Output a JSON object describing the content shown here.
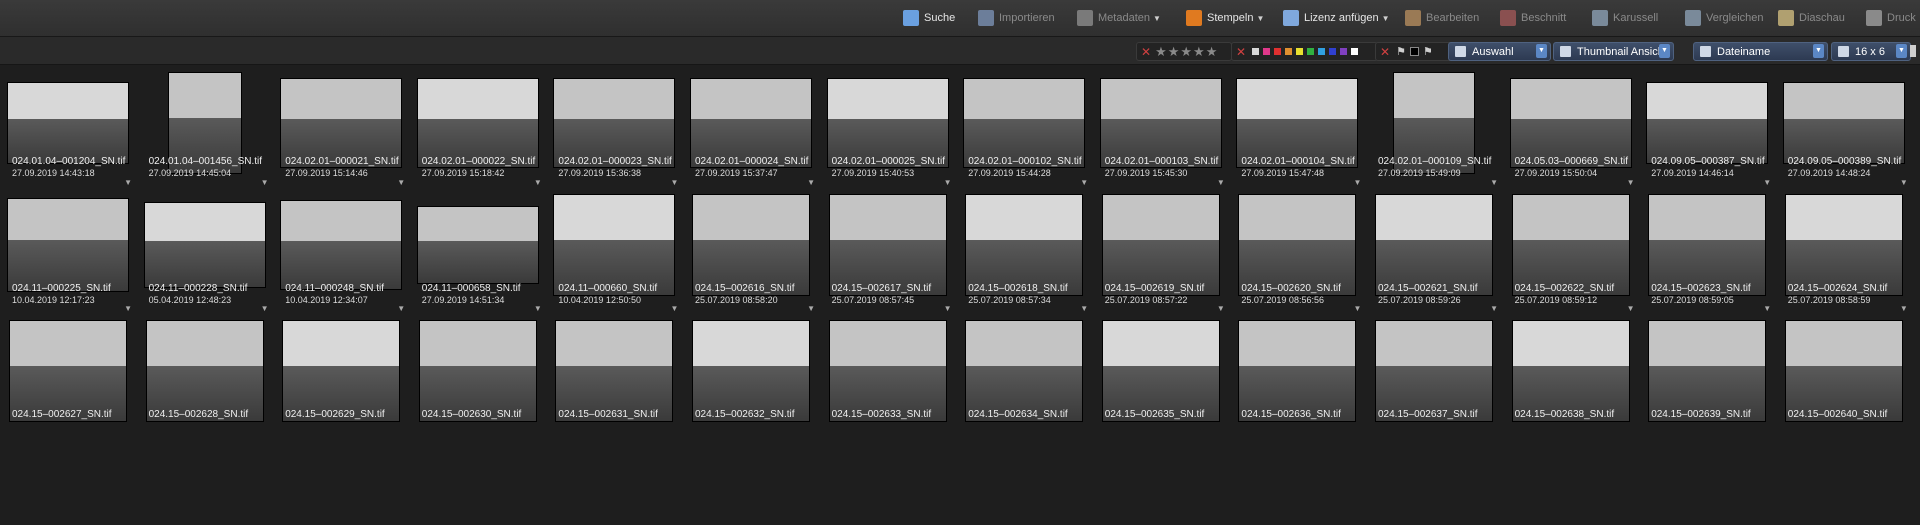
{
  "toolbar": {
    "items": [
      {
        "label": "Suche",
        "icon": "search-icon",
        "enabled": true,
        "caret": false
      },
      {
        "label": "Importieren",
        "icon": "import-icon",
        "enabled": false,
        "caret": false
      },
      {
        "label": "Metadaten",
        "icon": "metadata-icon",
        "enabled": false,
        "caret": true
      },
      {
        "label": "Stempeln",
        "icon": "stamp-icon",
        "enabled": true,
        "caret": true
      },
      {
        "label": "Lizenz anfügen",
        "icon": "license-icon",
        "enabled": true,
        "caret": true
      },
      {
        "label": "Bearbeiten",
        "icon": "palette-icon",
        "enabled": false,
        "caret": false
      },
      {
        "label": "Beschnitt",
        "icon": "crop-icon",
        "enabled": false,
        "caret": false
      },
      {
        "label": "Karussell",
        "icon": "carousel-icon",
        "enabled": false,
        "caret": false
      },
      {
        "label": "Vergleichen",
        "icon": "compare-icon",
        "enabled": false,
        "caret": false
      },
      {
        "label": "Diaschau",
        "icon": "slideshow-icon",
        "enabled": false,
        "caret": false
      },
      {
        "label": "Druck",
        "icon": "print-icon",
        "enabled": false,
        "caret": false
      }
    ]
  },
  "filters": {
    "rating_stars": 5,
    "colors": [
      "#d8d8d8",
      "#e0388a",
      "#e03030",
      "#e09030",
      "#e8e030",
      "#30b040",
      "#30a0e0",
      "#3040d0",
      "#8040c0",
      "#ffffff"
    ],
    "selection_dropdown": "Auswahl",
    "view_dropdown": "Thumbnail Ansicht",
    "sort_dropdown": "Dateiname",
    "grid_dropdown": "16 x 6"
  },
  "thumbnails": [
    {
      "name": "024.01.04–001204_SN.tif",
      "date": "27.09.2019 14:43:18"
    },
    {
      "name": "024.01.04–001456_SN.tif",
      "date": "27.09.2019 14:45:04"
    },
    {
      "name": "024.02.01–000021_SN.tif",
      "date": "27.09.2019 15:14:46"
    },
    {
      "name": "024.02.01–000022_SN.tif",
      "date": "27.09.2019 15:18:42"
    },
    {
      "name": "024.02.01–000023_SN.tif",
      "date": "27.09.2019 15:36:38"
    },
    {
      "name": "024.02.01–000024_SN.tif",
      "date": "27.09.2019 15:37:47"
    },
    {
      "name": "024.02.01–000025_SN.tif",
      "date": "27.09.2019 15:40:53"
    },
    {
      "name": "024.02.01–000102_SN.tif",
      "date": "27.09.2019 15:44:28"
    },
    {
      "name": "024.02.01–000103_SN.tif",
      "date": "27.09.2019 15:45:30"
    },
    {
      "name": "024.02.01–000104_SN.tif",
      "date": "27.09.2019 15:47:48"
    },
    {
      "name": "024.02.01–000109_SN.tif",
      "date": "27.09.2019 15:49:09"
    },
    {
      "name": "024.05.03–000669_SN.tif",
      "date": "27.09.2019 15:50:04"
    },
    {
      "name": "024.09.05–000387_SN.tif",
      "date": "27.09.2019 14:46:14"
    },
    {
      "name": "024.09.05–000389_SN.tif",
      "date": "27.09.2019 14:48:24"
    },
    {
      "name": "024.11–000225_SN.tif",
      "date": "10.04.2019 12:17:23"
    },
    {
      "name": "024.11–000228_SN.tif",
      "date": "05.04.2019 12:48:23"
    },
    {
      "name": "024.11–000248_SN.tif",
      "date": "10.04.2019 12:34:07"
    },
    {
      "name": "024.11–000658_SN.tif",
      "date": "27.09.2019 14:51:34"
    },
    {
      "name": "024.11–000660_SN.tif",
      "date": "10.04.2019 12:50:50"
    },
    {
      "name": "024.15–002616_SN.tif",
      "date": "25.07.2019 08:58:20"
    },
    {
      "name": "024.15–002617_SN.tif",
      "date": "25.07.2019 08:57:45"
    },
    {
      "name": "024.15–002618_SN.tif",
      "date": "25.07.2019 08:57:34"
    },
    {
      "name": "024.15–002619_SN.tif",
      "date": "25.07.2019 08:57:22"
    },
    {
      "name": "024.15–002620_SN.tif",
      "date": "25.07.2019 08:56:56"
    },
    {
      "name": "024.15–002621_SN.tif",
      "date": "25.07.2019 08:59:26"
    },
    {
      "name": "024.15–002622_SN.tif",
      "date": "25.07.2019 08:59:12"
    },
    {
      "name": "024.15–002623_SN.tif",
      "date": "25.07.2019 08:59:05"
    },
    {
      "name": "024.15–002624_SN.tif",
      "date": "25.07.2019 08:58:59"
    },
    {
      "name": "024.15–002627_SN.tif",
      "date": ""
    },
    {
      "name": "024.15–002628_SN.tif",
      "date": ""
    },
    {
      "name": "024.15–002629_SN.tif",
      "date": ""
    },
    {
      "name": "024.15–002630_SN.tif",
      "date": ""
    },
    {
      "name": "024.15–002631_SN.tif",
      "date": ""
    },
    {
      "name": "024.15–002632_SN.tif",
      "date": ""
    },
    {
      "name": "024.15–002633_SN.tif",
      "date": ""
    },
    {
      "name": "024.15–002634_SN.tif",
      "date": ""
    },
    {
      "name": "024.15–002635_SN.tif",
      "date": ""
    },
    {
      "name": "024.15–002636_SN.tif",
      "date": ""
    },
    {
      "name": "024.15–002637_SN.tif",
      "date": ""
    },
    {
      "name": "024.15–002638_SN.tif",
      "date": ""
    },
    {
      "name": "024.15–002639_SN.tif",
      "date": ""
    },
    {
      "name": "024.15–002640_SN.tif",
      "date": ""
    }
  ]
}
